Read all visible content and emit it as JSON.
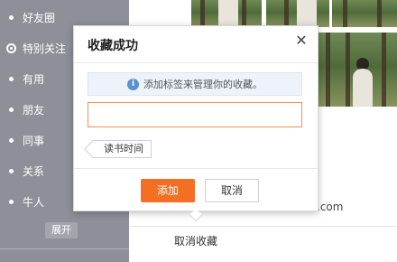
{
  "sidebar": {
    "items": [
      {
        "label": "好友圈",
        "icon": "bullet-icon"
      },
      {
        "label": "特别关注",
        "icon": "target-icon"
      },
      {
        "label": "有用",
        "icon": "bullet-icon"
      },
      {
        "label": "朋友",
        "icon": "bullet-icon"
      },
      {
        "label": "同事",
        "icon": "bullet-icon"
      },
      {
        "label": "关系",
        "icon": "bullet-icon"
      },
      {
        "label": "牛人",
        "icon": "bullet-icon"
      }
    ],
    "expand_label": "展开"
  },
  "main": {
    "url_text": ".com",
    "cancel_favorite_label": "取消收藏"
  },
  "dialog": {
    "title": "收藏成功",
    "close_icon": "close-icon",
    "tip_icon": "info-icon",
    "tip_text": "添加标签来管理你的收藏。",
    "tag_input_value": "",
    "suggested_tags": [
      "读书时间"
    ],
    "add_label": "添加",
    "cancel_label": "取消"
  },
  "colors": {
    "sidebar_bg": "#8f8f99",
    "accent": "#f36f24",
    "input_border": "#f09155",
    "tip_bg": "#eef3fa"
  }
}
